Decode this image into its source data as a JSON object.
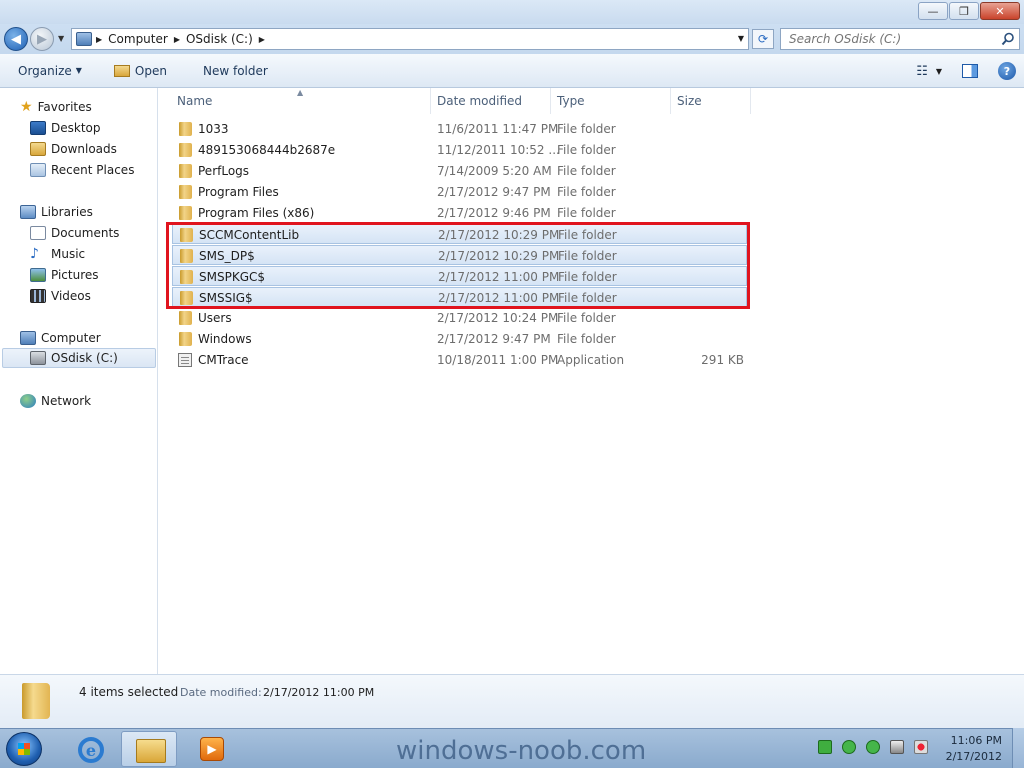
{
  "window": {
    "buttons": [
      "minimize",
      "maximize",
      "close"
    ],
    "close_glyph": "✕",
    "max_glyph": "❐",
    "min_glyph": "—"
  },
  "address": {
    "crumbs": [
      "Computer",
      "OSdisk (C:)"
    ],
    "search_placeholder": "Search OSdisk (C:)"
  },
  "toolbar": {
    "organize_label": "Organize",
    "open_label": "Open",
    "new_folder_label": "New folder"
  },
  "nav": {
    "favorites_label": "Favorites",
    "favorites": [
      "Desktop",
      "Downloads",
      "Recent Places"
    ],
    "libraries_label": "Libraries",
    "libraries": [
      "Documents",
      "Music",
      "Pictures",
      "Videos"
    ],
    "computer_label": "Computer",
    "computer_items": [
      "OSdisk (C:)"
    ],
    "network_label": "Network"
  },
  "columns": [
    "Name",
    "Date modified",
    "Type",
    "Size"
  ],
  "files": [
    {
      "name": "1033",
      "date": "11/6/2011 11:47 PM",
      "type": "File folder",
      "size": "",
      "kind": "folder",
      "selected": false
    },
    {
      "name": "489153068444b2687e",
      "date": "11/12/2011 10:52 ...",
      "type": "File folder",
      "size": "",
      "kind": "folder",
      "selected": false
    },
    {
      "name": "PerfLogs",
      "date": "7/14/2009 5:20 AM",
      "type": "File folder",
      "size": "",
      "kind": "folder",
      "selected": false
    },
    {
      "name": "Program Files",
      "date": "2/17/2012 9:47 PM",
      "type": "File folder",
      "size": "",
      "kind": "folder",
      "selected": false
    },
    {
      "name": "Program Files (x86)",
      "date": "2/17/2012 9:46 PM",
      "type": "File folder",
      "size": "",
      "kind": "folder",
      "selected": false
    },
    {
      "name": "SCCMContentLib",
      "date": "2/17/2012 10:29 PM",
      "type": "File folder",
      "size": "",
      "kind": "folder",
      "selected": true
    },
    {
      "name": "SMS_DP$",
      "date": "2/17/2012 10:29 PM",
      "type": "File folder",
      "size": "",
      "kind": "folder",
      "selected": true
    },
    {
      "name": "SMSPKGC$",
      "date": "2/17/2012 11:00 PM",
      "type": "File folder",
      "size": "",
      "kind": "folder",
      "selected": true
    },
    {
      "name": "SMSSIG$",
      "date": "2/17/2012 11:00 PM",
      "type": "File folder",
      "size": "",
      "kind": "folder",
      "selected": true
    },
    {
      "name": "Users",
      "date": "2/17/2012 10:24 PM",
      "type": "File folder",
      "size": "",
      "kind": "folder",
      "selected": false
    },
    {
      "name": "Windows",
      "date": "2/17/2012 9:47 PM",
      "type": "File folder",
      "size": "",
      "kind": "folder",
      "selected": false
    },
    {
      "name": "CMTrace",
      "date": "10/18/2011 1:00 PM",
      "type": "Application",
      "size": "291 KB",
      "kind": "app",
      "selected": false
    }
  ],
  "details": {
    "selection_count": "4 items selected",
    "date_label": "Date modified:",
    "date_value": "2/17/2012 11:00 PM"
  },
  "taskbar": {
    "watermark": "windows-noob.com",
    "clock_time": "11:06 PM",
    "clock_date": "2/17/2012"
  },
  "colors": {
    "selection_box": "#e0141e",
    "selected_row": "#d5e4f5"
  }
}
